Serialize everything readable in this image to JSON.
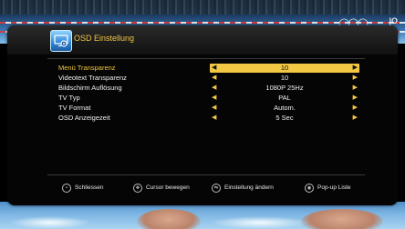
{
  "background": {
    "top_logo": "◯◯◯",
    "channel_bug": "|O"
  },
  "panel": {
    "title": "OSD Einstellung",
    "title_icon": "settings-tv-icon",
    "accent_color": "#f2c744"
  },
  "settings": [
    {
      "label": "Menü Transparenz",
      "value": "10",
      "selected": true
    },
    {
      "label": "Videotext Transparenz",
      "value": "10",
      "selected": false
    },
    {
      "label": "Bildschirm Auflösung",
      "value": "1080P 25Hz",
      "selected": false
    },
    {
      "label": "TV Typ",
      "value": "PAL",
      "selected": false
    },
    {
      "label": "TV Format",
      "value": "Autom.",
      "selected": false
    },
    {
      "label": "OSD Anzeigezeit",
      "value": "5 Sec",
      "selected": false
    }
  ],
  "footer": {
    "hints": [
      {
        "icon": "exit-button-icon",
        "label": "Schliessen"
      },
      {
        "icon": "navigate-button-icon",
        "label": "Cursor bewegen"
      },
      {
        "icon": "left-right-button-icon",
        "label": "Einstellung ändern"
      },
      {
        "icon": "ok-button-icon",
        "label": "Pop-up Liste"
      }
    ]
  }
}
